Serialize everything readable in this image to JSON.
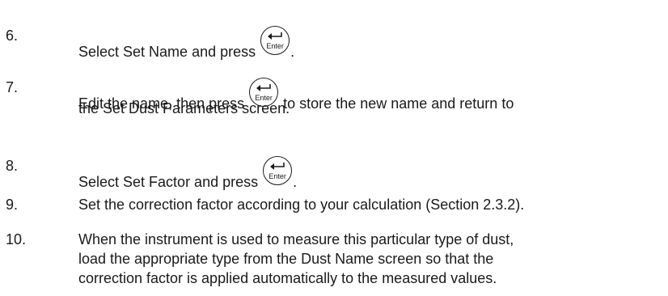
{
  "steps": [
    {
      "number": "6.",
      "parts": [
        "Select Set Name and press",
        "."
      ]
    },
    {
      "number": "7.",
      "parts": [
        "Edit the name, then press",
        "to store the new name and return to"
      ],
      "line2": "the Set Dust Parameters screen."
    },
    {
      "number": "8.",
      "parts": [
        "Select Set Factor and press",
        "."
      ]
    },
    {
      "number": "9.",
      "text": "Set the correction factor according to your calculation (Section 2.3.2)."
    },
    {
      "number": "10.",
      "lines": [
        "When the instrument is used to measure this particular type of dust,",
        "load the appropriate type from the Dust Name screen so that the",
        "correction factor is applied automatically to the measured values."
      ]
    }
  ],
  "enter_key": {
    "label": "Enter",
    "icon": "enter-return-arrow-icon"
  }
}
